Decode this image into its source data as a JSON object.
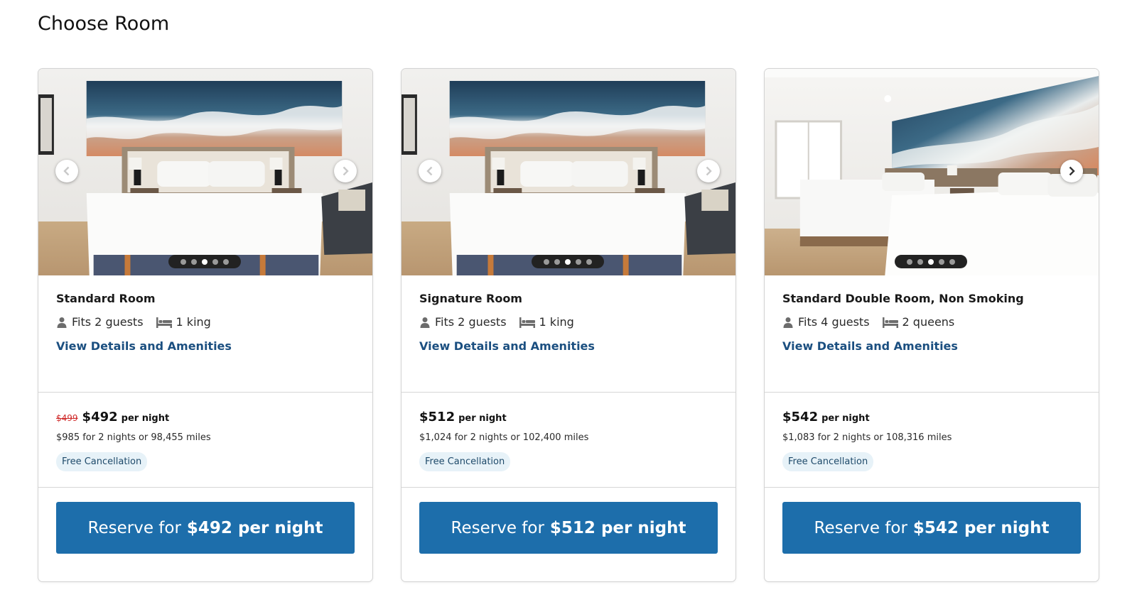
{
  "page": {
    "title": "Choose Room"
  },
  "rooms": [
    {
      "name": "Standard Room",
      "guests": "Fits 2 guests",
      "beds": "1 king",
      "details_link": "View Details and Amenities",
      "original_price": "$499",
      "price": "$492",
      "price_unit": "per night",
      "total": "$985 for 2 nights or 98,455 miles",
      "badge": "Free Cancellation",
      "reserve_prefix": "Reserve for",
      "reserve_amount": "$492 per night",
      "carousel_active_index": 3,
      "carousel_count": 5
    },
    {
      "name": "Signature Room",
      "guests": "Fits 2 guests",
      "beds": "1 king",
      "details_link": "View Details and Amenities",
      "price": "$512",
      "price_unit": "per night",
      "total": "$1,024 for 2 nights or 102,400 miles",
      "badge": "Free Cancellation",
      "reserve_prefix": "Reserve for",
      "reserve_amount": "$512 per night",
      "carousel_active_index": 3,
      "carousel_count": 5
    },
    {
      "name": "Standard Double Room, Non Smoking",
      "guests": "Fits 4 guests",
      "beds": "2 queens",
      "details_link": "View Details and Amenities",
      "price": "$542",
      "price_unit": "per night",
      "total": "$1,083 for 2 nights or 108,316 miles",
      "badge": "Free Cancellation",
      "reserve_prefix": "Reserve for",
      "reserve_amount": "$542 per night",
      "carousel_active_index": 3,
      "carousel_count": 5
    }
  ],
  "icons": {
    "guests": "person-icon",
    "beds": "bed-icon",
    "prev": "chevron-left-icon",
    "next": "chevron-right-icon"
  },
  "colors": {
    "button": "#1d6eab",
    "link": "#1b4f80",
    "strike_price": "#cf2a2a",
    "badge_bg": "#e7f2f8"
  }
}
